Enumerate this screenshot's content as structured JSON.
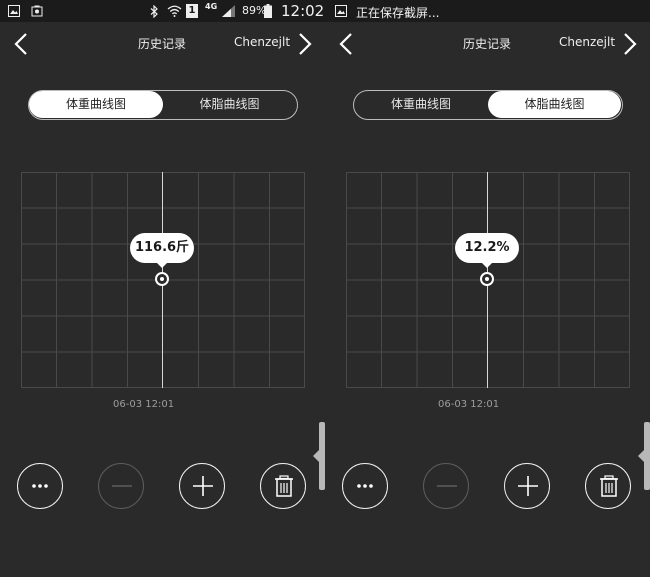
{
  "statusbar_left": {
    "battery": "89%",
    "time": "12:02",
    "network": "4G",
    "sim": "1"
  },
  "statusbar_right": {
    "notification": "正在保存截屏..."
  },
  "navbar": {
    "title": "历史记录",
    "user": "Chenzejlt"
  },
  "tabs": [
    "体重曲线图",
    "体脂曲线图"
  ],
  "screen_left": {
    "active_tab": 0,
    "value_label": "116.6斤",
    "date": "06-03 12:01"
  },
  "screen_right": {
    "active_tab": 1,
    "value_label": "12.2%",
    "date": "06-03 12:01"
  },
  "chart_data": [
    {
      "type": "line",
      "x": [
        "06-03 12:01"
      ],
      "values": [
        116.6
      ],
      "series_unit": "斤",
      "grid": true
    },
    {
      "type": "line",
      "x": [
        "06-03 12:01"
      ],
      "values": [
        12.2
      ],
      "series_unit": "%",
      "grid": true
    }
  ],
  "actions": [
    {
      "icon": "more-icon",
      "enabled": true
    },
    {
      "icon": "minus-icon",
      "enabled": false
    },
    {
      "icon": "plus-icon",
      "enabled": true
    },
    {
      "icon": "trash-icon",
      "enabled": true
    }
  ],
  "colors": {
    "background": "#2a2a2a",
    "status_bar": "#1b1b1b",
    "foreground": "#ffffff",
    "muted": "#9d9d9d",
    "grid": "#4a4a4a",
    "disabled": "#5c5c5c"
  }
}
